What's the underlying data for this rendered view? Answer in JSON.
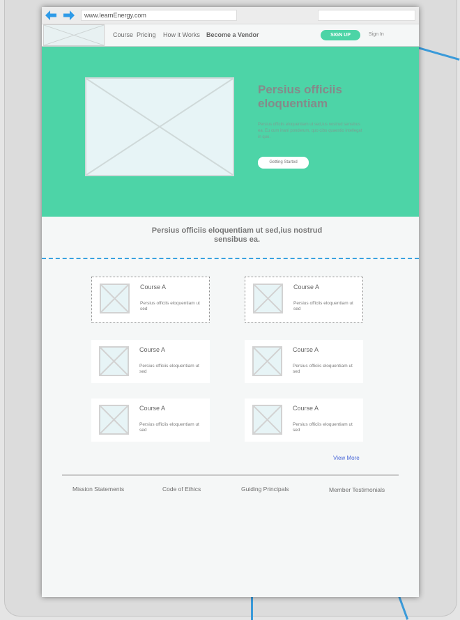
{
  "browser": {
    "url": "www.learnEnergy.com",
    "search_value": ""
  },
  "nav": {
    "links": [
      "Course",
      "Pricing",
      "How it Works",
      "Become a Vendor"
    ],
    "signup_label": "SIGN UP",
    "signin_label": "Sign In"
  },
  "hero": {
    "title": "Persius officiis eloquentiam",
    "text": "Persius officiis eloquentiam ut sed,ius nostrud sensibus ea. Eu cum inani ponderum, quo cibo quaestio intellegat in quo.",
    "button_label": "Getting Started"
  },
  "tagline": "Persius officiis eloquentiam ut sed,ius nostrud sensibus ea.",
  "courses": [
    {
      "title": "Course A",
      "desc": "Persius officiis eloquentiam ut sed"
    },
    {
      "title": "Course A",
      "desc": "Persius officiis eloquentiam ut sed"
    },
    {
      "title": "Course A",
      "desc": "Persius officiis eloquentiam ut sed"
    },
    {
      "title": "Course A",
      "desc": "Persius officiis eloquentiam ut sed"
    },
    {
      "title": "Course A",
      "desc": "Persius officiis eloquentiam ut sed"
    },
    {
      "title": "Course A",
      "desc": "Persius officiis eloquentiam ut sed"
    }
  ],
  "view_more_label": "View More",
  "footer": {
    "links": [
      "Mission Statements",
      "Code of Ethics",
      "Guiding Principals",
      "Member Testimonials"
    ]
  },
  "colors": {
    "accent": "#4dd4a7",
    "link": "#4a68d8",
    "arrow": "#2f9be8"
  }
}
